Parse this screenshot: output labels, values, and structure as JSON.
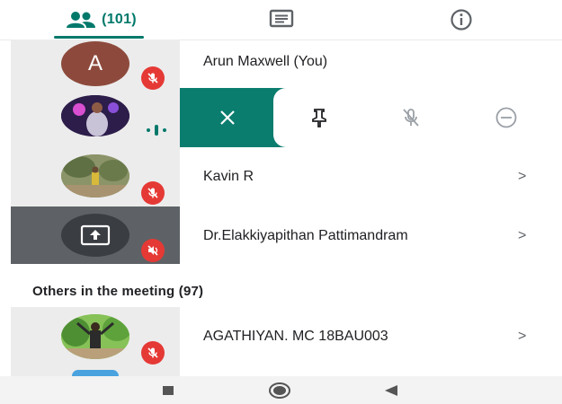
{
  "tabs": {
    "people_count": "(101)",
    "chat_icon": "chat-icon",
    "info_icon": "info-icon"
  },
  "participants": [
    {
      "name": "Arun Maxwell (You)",
      "avatar_letter": "A",
      "status": "muted"
    },
    {
      "name": "",
      "status": "speaking"
    },
    {
      "name": "Kavin R",
      "status": "muted",
      "chevron": ">"
    },
    {
      "name": "Dr.Elakkiyapithan Pattimandram",
      "status": "presenting-muted",
      "chevron": ">"
    }
  ],
  "actions": {
    "close_icon": "close-icon",
    "pin_icon": "pin-icon",
    "mute_icon": "mic-off-icon",
    "remove_icon": "remove-icon"
  },
  "others": {
    "title": "Others in the meeting (97)",
    "items": [
      {
        "name": "AGATHIYAN. MC 18BAU003",
        "status": "muted",
        "chevron": ">"
      }
    ]
  },
  "colors": {
    "accent": "#00796b",
    "mute_red": "#e53935",
    "column_grey": "#ececec"
  },
  "navbar": {
    "recent_icon": "square-icon",
    "home_icon": "circle-icon",
    "back_icon": "triangle-back-icon"
  }
}
